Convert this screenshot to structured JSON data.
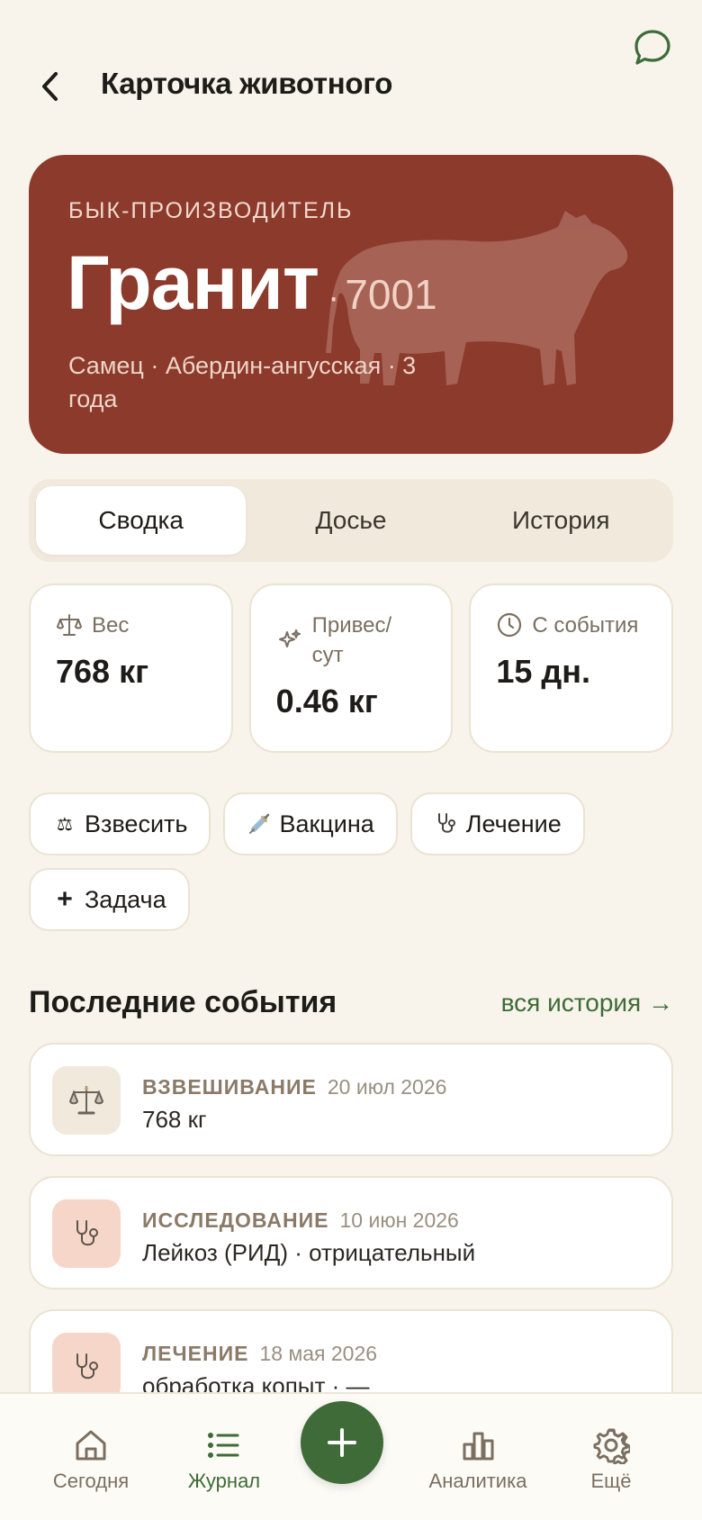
{
  "header": {
    "title": "Карточка животного"
  },
  "hero": {
    "role": "БЫК-ПРОИЗВОДИТЕЛЬ",
    "name": "Гранит",
    "separator": "·",
    "id": "7001",
    "meta": "Самец · Абердин-ангусская · 3 года"
  },
  "tabs": [
    {
      "label": "Сводка",
      "active": true
    },
    {
      "label": "Досье",
      "active": false
    },
    {
      "label": "История",
      "active": false
    }
  ],
  "stats": [
    {
      "label": "Вес",
      "value": "768 кг",
      "icon": "scale-icon"
    },
    {
      "label": "Привес/ сут",
      "value": "0.46 кг",
      "icon": "sparkle-icon"
    },
    {
      "label": "С события",
      "value": "15 дн.",
      "icon": "clock-icon"
    }
  ],
  "actions": [
    {
      "label": "Взвесить",
      "icon": "scale-icon",
      "glyph": "⚖"
    },
    {
      "label": "Вакцина",
      "icon": "syringe-icon",
      "glyph": "💉"
    },
    {
      "label": "Лечение",
      "icon": "stethoscope-icon",
      "glyph": ""
    },
    {
      "label": "Задача",
      "icon": "plus-icon",
      "glyph": "+"
    }
  ],
  "recent": {
    "title": "Последние события",
    "link": "вся история →"
  },
  "events": [
    {
      "type": "ВЗВЕШИВАНИЕ",
      "date": "20 июл 2026",
      "desc": "768 кг",
      "icon": "scale-icon"
    },
    {
      "type": "ИССЛЕДОВАНИЕ",
      "date": "10 июн 2026",
      "desc": "Лейкоз (РИД) · отрицательный",
      "icon": "stethoscope-icon"
    },
    {
      "type": "ЛЕЧЕНИЕ",
      "date": "18 мая 2026",
      "desc": "обработка копыт · —",
      "icon": "stethoscope-icon"
    }
  ],
  "nav": [
    {
      "label": "Сегодня",
      "icon": "home-icon"
    },
    {
      "label": "Журнал",
      "icon": "list-icon",
      "active": true
    },
    {
      "label": "Аналитика",
      "icon": "chart-icon"
    },
    {
      "label": "Ещё",
      "icon": "gear-icon"
    }
  ],
  "colors": {
    "background": "#f8f4eb",
    "hero": "#8b3a2b",
    "accent": "#3f6b38",
    "rose": "#f7d6ca"
  }
}
